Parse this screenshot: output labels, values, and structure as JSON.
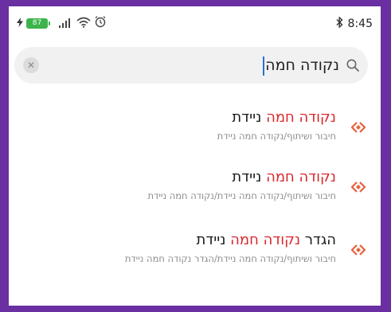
{
  "status_bar": {
    "charging_icon": "lightning-icon",
    "battery_level": "87",
    "signal_icon": "signal-bars-icon",
    "wifi_icon": "wifi-icon",
    "alarm_icon": "alarm-clock-icon",
    "bluetooth_icon": "bluetooth-icon",
    "time": "8:45"
  },
  "search": {
    "query": "נקודה חמה",
    "clear_icon": "close-icon",
    "search_icon": "search-icon"
  },
  "results": [
    {
      "title_before": "",
      "title_highlight": "נקודה חמה",
      "title_after": " ניידת",
      "path": "חיבור ושיתוף/נקודה חמה ניידת",
      "icon": "hotspot-icon"
    },
    {
      "title_before": "",
      "title_highlight": "נקודה חמה",
      "title_after": " ניידת",
      "path": "חיבור ושיתוף/נקודה חמה ניידת/נקודה חמה ניידת",
      "icon": "hotspot-icon"
    },
    {
      "title_before": "הגדר ",
      "title_highlight": "נקודה חמה",
      "title_after": " ניידת",
      "path": "חיבור ושיתוף/נקודה חמה ניידת/הגדר נקודה חמה ניידת",
      "icon": "hotspot-icon"
    }
  ],
  "colors": {
    "frame": "#6a2fa0",
    "highlight": "#d9282e",
    "icon_accent": "#e8603c",
    "battery": "#3cb44b",
    "caret": "#2d6fd6"
  }
}
